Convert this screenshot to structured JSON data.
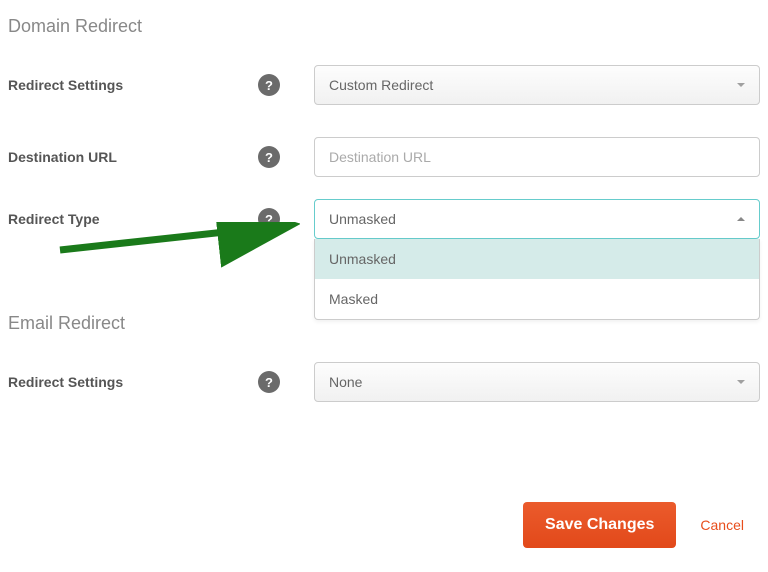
{
  "domain": {
    "section_title": "Domain Redirect",
    "redirect_settings_label": "Redirect Settings",
    "redirect_settings_value": "Custom Redirect",
    "destination_url_label": "Destination URL",
    "destination_url_placeholder": "Destination URL",
    "destination_url_value": "",
    "redirect_type_label": "Redirect Type",
    "redirect_type_value": "Unmasked",
    "redirect_type_options": {
      "0": "Unmasked",
      "1": "Masked"
    }
  },
  "email": {
    "section_title": "Email Redirect",
    "redirect_settings_label": "Redirect Settings",
    "redirect_settings_value": "None"
  },
  "actions": {
    "save": "Save Changes",
    "cancel": "Cancel"
  },
  "help_glyph": "?"
}
